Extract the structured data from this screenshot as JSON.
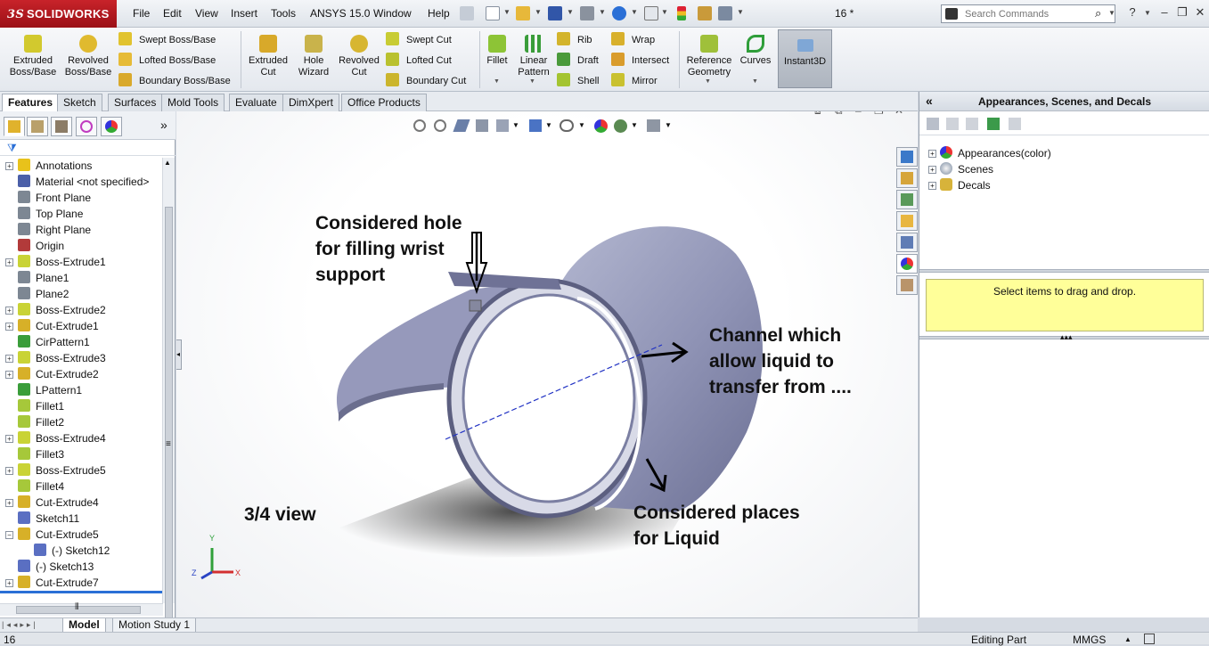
{
  "app": {
    "logo": "SOLIDWORKS",
    "document": "16 *"
  },
  "menu": [
    "File",
    "Edit",
    "View",
    "Insert",
    "Tools",
    "ANSYS 15.0",
    "Window",
    "Help"
  ],
  "search": {
    "placeholder": "Search Commands"
  },
  "ribbon": {
    "extruded_boss": "Extruded\nBoss/Base",
    "revolved_boss": "Revolved\nBoss/Base",
    "swept_boss": "Swept Boss/Base",
    "lofted_boss": "Lofted Boss/Base",
    "boundary_boss": "Boundary Boss/Base",
    "extruded_cut": "Extruded\nCut",
    "hole_wizard": "Hole\nWizard",
    "revolved_cut": "Revolved\nCut",
    "swept_cut": "Swept Cut",
    "lofted_cut": "Lofted Cut",
    "boundary_cut": "Boundary Cut",
    "fillet": "Fillet",
    "linear_pattern": "Linear\nPattern",
    "rib": "Rib",
    "draft": "Draft",
    "shell": "Shell",
    "wrap": "Wrap",
    "intersect": "Intersect",
    "mirror": "Mirror",
    "reference_geometry": "Reference\nGeometry",
    "curves": "Curves",
    "instant3d": "Instant3D"
  },
  "tabs": [
    "Features",
    "Sketch",
    "Surfaces",
    "Mold Tools",
    "Evaluate",
    "DimXpert",
    "Office Products"
  ],
  "feature_tree": [
    {
      "label": "Annotations",
      "expand": true,
      "icon": "annotations-icon",
      "color": "#e8c21b"
    },
    {
      "label": "Material <not specified>",
      "expand": false,
      "icon": "material-icon",
      "color": "#4b5fa8"
    },
    {
      "label": "Front Plane",
      "expand": false,
      "icon": "plane-icon",
      "color": "#7d8793"
    },
    {
      "label": "Top Plane",
      "expand": false,
      "icon": "plane-icon",
      "color": "#7d8793"
    },
    {
      "label": "Right Plane",
      "expand": false,
      "icon": "plane-icon",
      "color": "#7d8793"
    },
    {
      "label": "Origin",
      "expand": false,
      "icon": "origin-icon",
      "color": "#b23a3a"
    },
    {
      "label": "Boss-Extrude1",
      "expand": true,
      "icon": "boss-extrude-icon",
      "color": "#c9d335"
    },
    {
      "label": "Plane1",
      "expand": false,
      "icon": "plane-icon",
      "color": "#7d8793"
    },
    {
      "label": "Plane2",
      "expand": false,
      "icon": "plane-icon",
      "color": "#7d8793"
    },
    {
      "label": "Boss-Extrude2",
      "expand": true,
      "icon": "boss-extrude-icon",
      "color": "#c9d335"
    },
    {
      "label": "Cut-Extrude1",
      "expand": true,
      "icon": "cut-extrude-icon",
      "color": "#d7b028"
    },
    {
      "label": "CirPattern1",
      "expand": false,
      "icon": "circular-pattern-icon",
      "color": "#3a9d3a"
    },
    {
      "label": "Boss-Extrude3",
      "expand": true,
      "icon": "boss-extrude-icon",
      "color": "#c9d335"
    },
    {
      "label": "Cut-Extrude2",
      "expand": true,
      "icon": "cut-extrude-icon",
      "color": "#d7b028"
    },
    {
      "label": "LPattern1",
      "expand": false,
      "icon": "linear-pattern-icon",
      "color": "#3a9d3a"
    },
    {
      "label": "Fillet1",
      "expand": false,
      "icon": "fillet-icon",
      "color": "#a6c83a"
    },
    {
      "label": "Fillet2",
      "expand": false,
      "icon": "fillet-icon",
      "color": "#a6c83a"
    },
    {
      "label": "Boss-Extrude4",
      "expand": true,
      "icon": "boss-extrude-icon",
      "color": "#c9d335"
    },
    {
      "label": "Fillet3",
      "expand": false,
      "icon": "fillet-icon",
      "color": "#a6c83a"
    },
    {
      "label": "Boss-Extrude5",
      "expand": true,
      "icon": "boss-extrude-icon",
      "color": "#c9d335"
    },
    {
      "label": "Fillet4",
      "expand": false,
      "icon": "fillet-icon",
      "color": "#a6c83a"
    },
    {
      "label": "Cut-Extrude4",
      "expand": true,
      "icon": "cut-extrude-icon",
      "color": "#d7b028"
    },
    {
      "label": "Sketch11",
      "expand": false,
      "icon": "sketch-icon",
      "color": "#5a6fc2"
    },
    {
      "label": "Cut-Extrude5",
      "expand": "open",
      "icon": "cut-extrude-icon",
      "color": "#d7b028"
    },
    {
      "label": "(-) Sketch12",
      "expand": false,
      "icon": "sketch-icon",
      "color": "#5a6fc2",
      "child": true
    },
    {
      "label": "(-) Sketch13",
      "expand": false,
      "icon": "sketch-icon",
      "color": "#5a6fc2"
    },
    {
      "label": "Cut-Extrude7",
      "expand": true,
      "icon": "cut-extrude-icon",
      "color": "#d7b028"
    }
  ],
  "annotations": {
    "hole": "Considered hole\nfor filling wrist\nsupport",
    "channel": "Channel which\nallow liquid to\ntransfer from ....",
    "view": "3/4 view",
    "liquid": "Considered places\nfor Liquid"
  },
  "triad": {
    "x": "X",
    "y": "Y",
    "z": "Z"
  },
  "task_pane": {
    "title": "Appearances, Scenes, and Decals",
    "items": [
      "Appearances(color)",
      "Scenes",
      "Decals"
    ],
    "drop_hint": "Select items to drag and drop."
  },
  "bottom_tabs": [
    "Model",
    "Motion Study 1"
  ],
  "status": {
    "left": "16",
    "mode": "Editing Part",
    "units": "MMGS"
  },
  "colors": {
    "accent": "#2a6fd6",
    "brand": "#b01a21",
    "part": "#8e92b2",
    "dropzone": "#ffff99"
  }
}
